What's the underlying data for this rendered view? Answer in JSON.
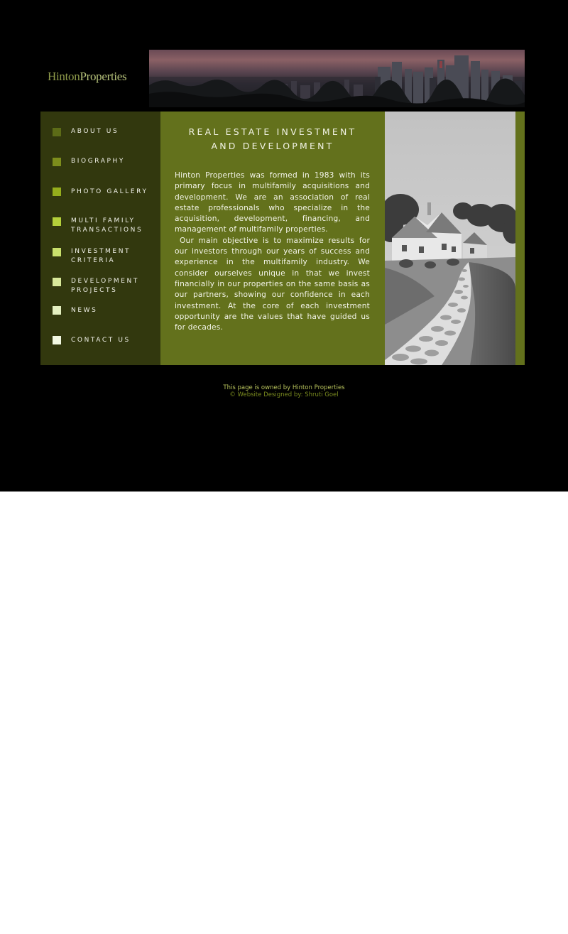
{
  "header": {
    "logo_first": "Hinton",
    "logo_second": "Properties"
  },
  "nav": {
    "items": [
      {
        "label": "ABOUT US",
        "color": "#5c6b17"
      },
      {
        "label": "BIOGRAPHY",
        "color": "#7d8d1c"
      },
      {
        "label": "PHOTO GALLERY",
        "color": "#95ae1c"
      },
      {
        "label": "MULTI FAMILY\nTRANSACTIONS",
        "color": "#b4d03a"
      },
      {
        "label": "INVESTMENT\nCRITERIA",
        "color": "#c9e06c"
      },
      {
        "label": "DEVELOPMENT\nPROJECTS",
        "color": "#d8e89a"
      },
      {
        "label": "NEWS",
        "color": "#e4efc0"
      },
      {
        "label": "CONTACT US",
        "color": "#f2f8e2"
      }
    ]
  },
  "content": {
    "title": "REAL ESTATE INVESTMENT\nAND DEVELOPMENT",
    "paragraph1": "Hinton Properties was formed in 1983 with its primary focus in multifamily acquisitions and development.   We are an association of real estate professionals who specialize in the acquisition, development, financing, and management of multifamily properties.",
    "paragraph2": "Our main objective is to maximize results for our investors through our years of success and experience in the multifamily industry.   We consider ourselves unique in that we invest financially in our properties on the same basis as our partners, showing our confidence in each investment.  At the core of each investment opportunity are the values that have guided us for decades."
  },
  "footer": {
    "owner": "This page is owned by Hinton Properties",
    "credit": "© Website Designed by: Shruti Goel"
  },
  "colors": {
    "page_background": "#000000",
    "nav_background": "#32380e",
    "content_background": "#63711c",
    "footer_owner": "#b8c35c",
    "footer_credit": "#7b8c1f"
  }
}
